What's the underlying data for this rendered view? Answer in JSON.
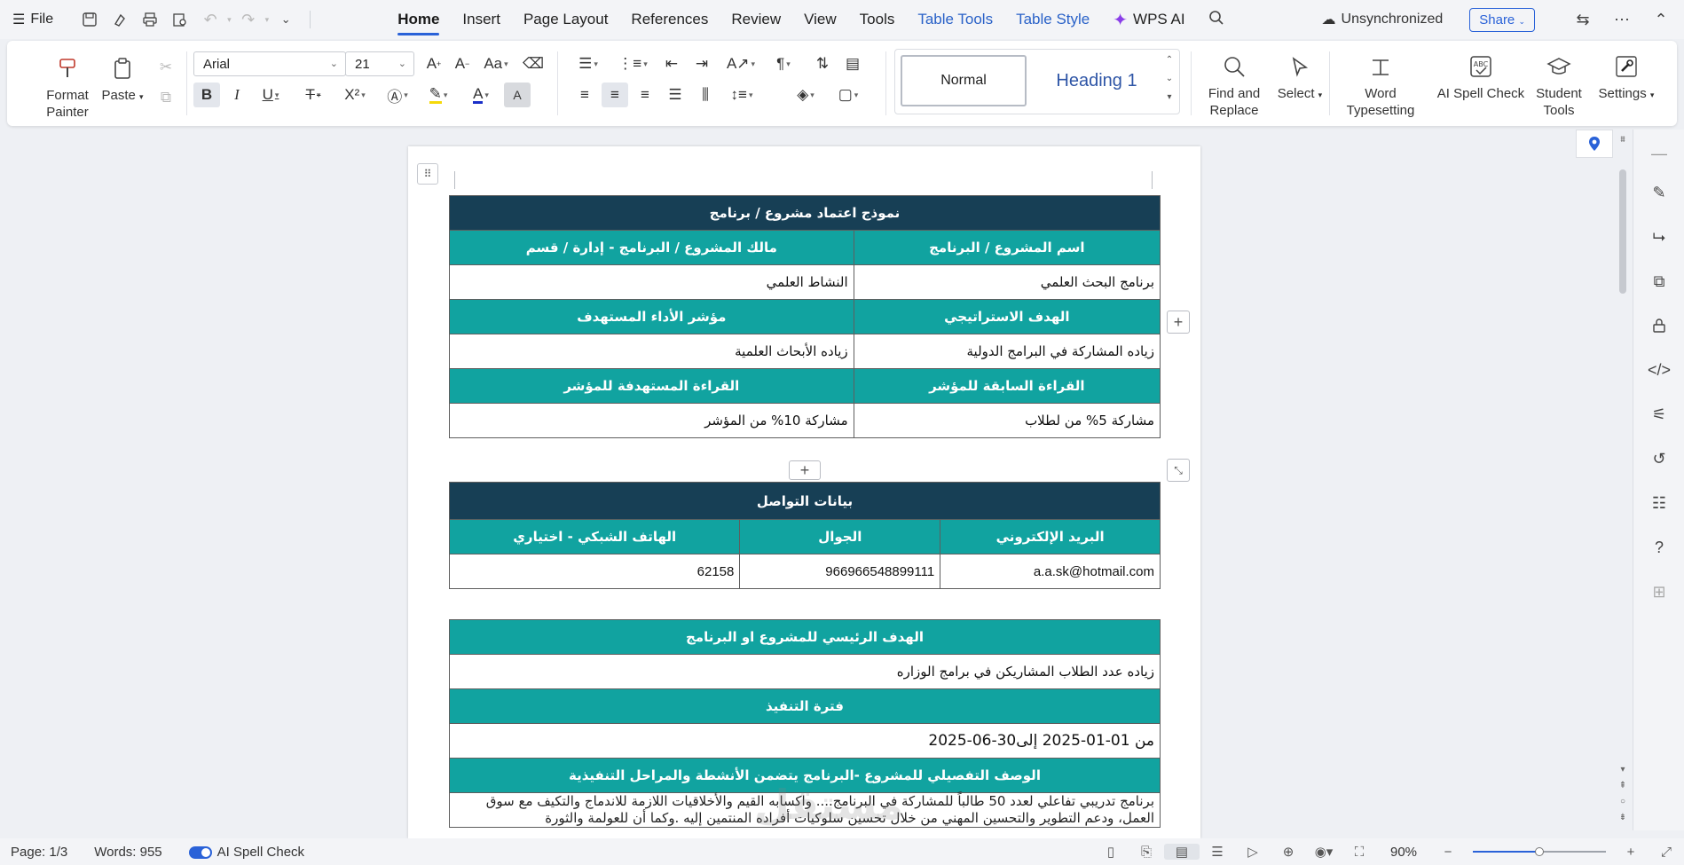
{
  "menubar": {
    "file_label": "File",
    "menus": [
      "Home",
      "Insert",
      "Page Layout",
      "References",
      "Review",
      "View",
      "Tools",
      "Table Tools",
      "Table Style"
    ],
    "active_menu": "Home",
    "wps_ai": "WPS AI",
    "unsync_label": "Unsynchronized",
    "share_label": "Share"
  },
  "ribbon": {
    "format_painter": "Format\nPainter",
    "paste": "Paste",
    "font_name": "Arial",
    "font_size": "21",
    "style_normal": "Normal",
    "style_heading1": "Heading 1",
    "find_replace": "Find and\nReplace",
    "select": "Select",
    "word_typesetting": "Word\nTypesetting",
    "ai_spell_check": "AI Spell Check",
    "student_tools": "Student\nTools",
    "settings": "Settings"
  },
  "doc": {
    "title": "نموذج اعتماد مشروع / برنامج",
    "t1": {
      "h_project_name": "اسم المشروع / البرنامج",
      "h_owner": "مالك المشروع / البرنامج - إدارة / قسم",
      "project_name": "برنامج البحث العلمي",
      "owner": "النشاط العلمي",
      "h_strategic_goal": "الهدف الاستراتيجي",
      "h_kpi": "مؤشر الأداء المستهدف",
      "strategic_goal": "زياده المشاركة في البرامج الدولية",
      "kpi": "زياده الأبحاث العلمية",
      "h_prev_reading": "القراءة السابقة للمؤشر",
      "h_target_reading": "القراءة المستهدفة للمؤشر",
      "prev_reading": "مشاركة 5% من لطلاب",
      "target_reading": "مشاركة 10% من المؤشر"
    },
    "t2": {
      "title": "بيانات التواصل",
      "h_email": "البريد الإلكتروني",
      "h_mobile": "الجوال",
      "h_phone": "الهاتف الشبكي - اختياري",
      "email": "a.a.sk@hotmail.com",
      "mobile": "966966548899111",
      "phone": "62158"
    },
    "t3": {
      "h_main_goal": "الهدف الرئيسي للمشروع او البرنامج",
      "main_goal": "زياده عدد الطلاب المشاريكن في برامج الوزاره",
      "h_period": "فترة التنفيذ",
      "period": "من 01-01-2025 إلى30-06-2025",
      "h_description": "الوصف التفصيلي للمشروع -البرنامج يتضمن الأنشطة والمراحل التنفيذية",
      "description": "برنامج تدريبي تفاعلي لعدد 50 طالباً للمشاركة في البرنامج.... واكسابه القيم والأخلاقيات اللازمة للاندماج والتكيف مع سوق العمل، ودعم التطوير والتحسين المهني من خلال تحسين سلوكيات أفراده المنتمين إليه .وكما أن للعولمة والثورة"
    },
    "watermark": "مستقل"
  },
  "status": {
    "page": "Page: 1/3",
    "words": "Words: 955",
    "spell": "AI Spell Check",
    "zoom": "90%",
    "zoom_fraction": 0.5
  },
  "colors": {
    "dark_header": "#173f55",
    "teal_header": "#11a3a0",
    "accent": "#2a62d8"
  }
}
